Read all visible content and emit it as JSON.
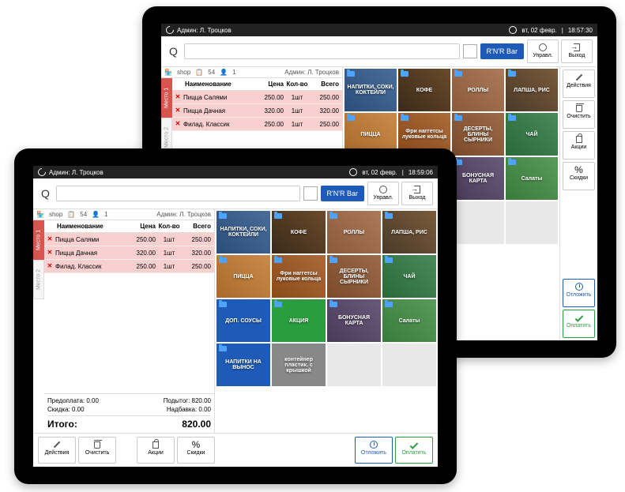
{
  "topbar": {
    "admin_label": "Админ: Л. Троцков",
    "date": "вт, 02 февр.",
    "time_back": "18:57:30",
    "time_front": "18:59:06"
  },
  "search": {
    "placeholder": "",
    "button": "R'N'R Bar"
  },
  "top_buttons": {
    "manage": "Управл.",
    "exit": "Выход"
  },
  "panel_header": {
    "shop": "shop",
    "table": "54",
    "guests": "1",
    "admin": "Админ: Л. Троцков"
  },
  "seats": {
    "seat1": "Место 1",
    "seat2": "Место 2"
  },
  "order_head": {
    "name": "Наименование",
    "price": "Цена",
    "qty": "Кол-во",
    "total": "Всего"
  },
  "order_rows": [
    {
      "name": "Пицца Салями",
      "price": "250.00",
      "qty": "1шт",
      "total": "250.00"
    },
    {
      "name": "Пицца Дачная",
      "price": "320.00",
      "qty": "1шт",
      "total": "320.00"
    },
    {
      "name": "Филад. Классик",
      "price": "250.00",
      "qty": "1шт",
      "total": "250.00"
    }
  ],
  "totals": {
    "prepay_label": "Предоплата:",
    "prepay": "0.00",
    "subtotal_label": "Подытог:",
    "subtotal": "820.00",
    "discount_label": "Скидка:",
    "discount": "0.00",
    "markup_label": "Надбавка:",
    "markup": "0.00",
    "total_label": "Итого:",
    "total": "820.00"
  },
  "buttons": {
    "actions": "Действия",
    "clear": "Очистить",
    "promos": "Акции",
    "discounts": "Скидки",
    "postpone": "Отложить",
    "pay": "Оплатить"
  },
  "categories": {
    "drinks": "НАПИТКИ, СОКИ, КОКТЕЙЛИ",
    "coffee": "КОФЕ",
    "rolls": "РОЛЛЫ",
    "noodle": "ЛАПША, РИС",
    "pizza": "ПИЦЦА",
    "nuggets": "Фри наггетсы луковые кольца",
    "dessert": "ДЕСЕРТЫ, БЛИНЫ СЫРНИКИ",
    "tea": "ЧАЙ",
    "sauce": "ДОП. СОУСЫ",
    "promo": "АКЦИЯ",
    "bonus": "БОНУСНАЯ КАРТА",
    "salad": "Салаты",
    "take": "НАПИТКИ НА ВЫНОС",
    "container": "контейнер пластик. с крышкой"
  }
}
